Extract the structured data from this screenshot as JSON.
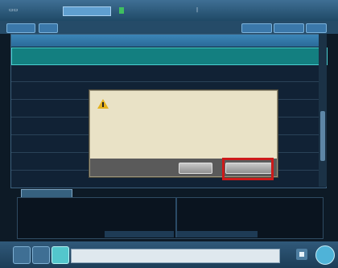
{
  "table": {
    "row_count": 7,
    "selected_row": 1
  },
  "dialog": {
    "icon": "warning-icon"
  },
  "colors": {
    "title_bar": "#2f5f84",
    "header": "#3c86b8",
    "selected_row": "#137f80",
    "dialog_bg": "#e9e2c6",
    "highlight_box": "#cc1a1a"
  }
}
